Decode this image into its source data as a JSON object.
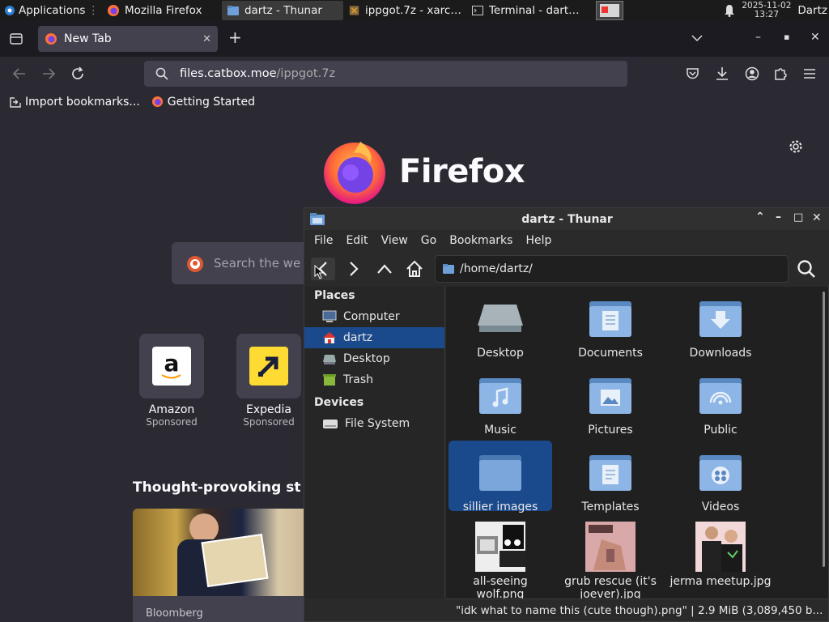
{
  "panel": {
    "apps_label": "Applications",
    "tasks": [
      {
        "label": "Mozilla Firefox",
        "icon": "firefox-icon"
      },
      {
        "label": "dartz - Thunar",
        "icon": "folder-icon"
      },
      {
        "label": "ippgot.7z - xarch...",
        "icon": "archive-icon"
      },
      {
        "label": "Terminal - dartz...",
        "icon": "terminal-icon"
      }
    ],
    "clock_date": "2025-11-02",
    "clock_time": "13:27",
    "user": "Dartz"
  },
  "firefox": {
    "tab_label": "New Tab",
    "url_host": "files.catbox.moe",
    "url_path": "/ippgot.7z",
    "bookmarks": [
      "Import bookmarks...",
      "Getting Started"
    ],
    "brand": "Firefox",
    "search_placeholder": "Search the we",
    "shortcuts": [
      {
        "name": "Amazon",
        "sub": "Sponsored"
      },
      {
        "name": "Expedia",
        "sub": "Sponsored"
      }
    ],
    "stories_heading": "Thought-provoking st",
    "story_source": "Bloomberg"
  },
  "thunar": {
    "title": "dartz - Thunar",
    "menu": [
      "File",
      "Edit",
      "View",
      "Go",
      "Bookmarks",
      "Help"
    ],
    "path": "/home/dartz/",
    "places_label": "Places",
    "places": [
      {
        "label": "Computer",
        "icon": "computer-icon"
      },
      {
        "label": "dartz",
        "icon": "home-icon",
        "selected": true
      },
      {
        "label": "Desktop",
        "icon": "desktop-icon"
      },
      {
        "label": "Trash",
        "icon": "trash-icon"
      }
    ],
    "devices_label": "Devices",
    "devices": [
      {
        "label": "File System",
        "icon": "drive-icon"
      }
    ],
    "files": [
      {
        "label": "Desktop",
        "icon": "desktop-folder-icon"
      },
      {
        "label": "Documents",
        "icon": "documents-folder-icon"
      },
      {
        "label": "Downloads",
        "icon": "downloads-folder-icon"
      },
      {
        "label": "Music",
        "icon": "music-folder-icon"
      },
      {
        "label": "Pictures",
        "icon": "pictures-folder-icon"
      },
      {
        "label": "Public",
        "icon": "public-folder-icon"
      },
      {
        "label": "sillier images",
        "icon": "folder-icon",
        "selected": true
      },
      {
        "label": "Templates",
        "icon": "templates-folder-icon"
      },
      {
        "label": "Videos",
        "icon": "videos-folder-icon"
      },
      {
        "label": "all-seeing wolf.png",
        "icon": "image-thumbnail"
      },
      {
        "label": "grub rescue (it's joever).jpg",
        "icon": "image-thumbnail"
      },
      {
        "label": "jerma meetup.jpg",
        "icon": "image-thumbnail"
      }
    ],
    "status": "\"idk what to name this (cute though).png\"  |  2.9 MiB (3,089,450 b..."
  },
  "colors": {
    "selection": "#1b4a8c",
    "folder": "#6f9fd8",
    "firefox_bg": "#2b2a33"
  }
}
